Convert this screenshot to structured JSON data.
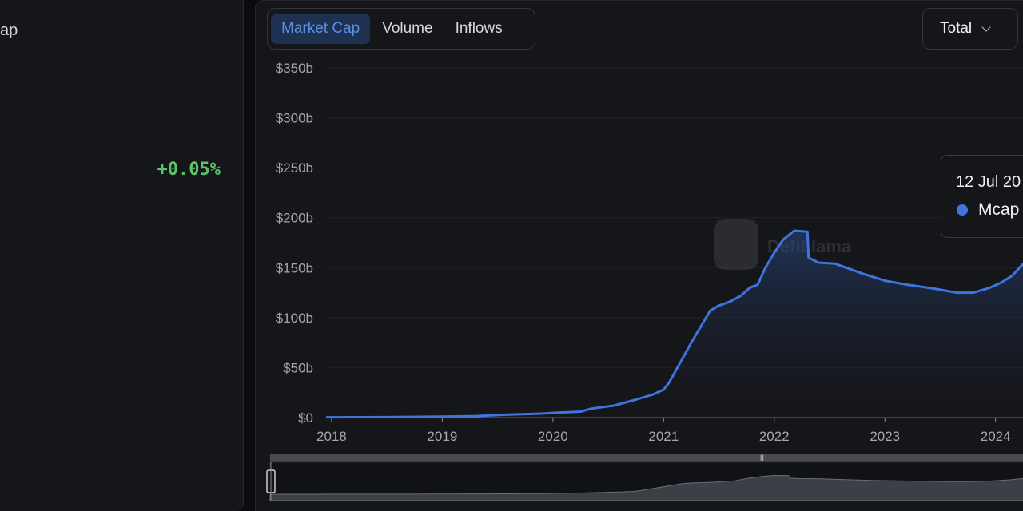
{
  "left": {
    "label": "ap",
    "change": "+0.05%",
    "change_color": "#5cc36b"
  },
  "tabs": [
    {
      "label": "Market Cap",
      "active": true
    },
    {
      "label": "Volume",
      "active": false
    },
    {
      "label": "Inflows",
      "active": false
    }
  ],
  "filter": {
    "label": "Total"
  },
  "tooltip": {
    "date": "12 Jul 20",
    "label": "Mcap",
    "color": "#3f74de"
  },
  "watermark": {
    "text": "DefiLlama"
  },
  "colors": {
    "line": "#3f74de",
    "accent": "#5b8fe2"
  },
  "chart_data": {
    "type": "area",
    "series": [
      {
        "name": "Mcap"
      }
    ],
    "y_ticks": [
      "$0",
      "$50b",
      "$100b",
      "$150b",
      "$200b",
      "$250b",
      "$300b",
      "$350b"
    ],
    "ylim": [
      0,
      350
    ],
    "x_ticks": [
      "2018",
      "2019",
      "2020",
      "2021",
      "2022",
      "2023",
      "2024"
    ],
    "xlim": [
      2017.95,
      2024.32
    ],
    "x": [
      2017.95,
      2018.5,
      2019.0,
      2019.3,
      2019.6,
      2019.9,
      2020.05,
      2020.25,
      2020.35,
      2020.55,
      2020.75,
      2020.9,
      2021.0,
      2021.05,
      2021.15,
      2021.25,
      2021.33,
      2021.42,
      2021.5,
      2021.6,
      2021.7,
      2021.78,
      2021.85,
      2021.92,
      2022.0,
      2022.08,
      2022.18,
      2022.3,
      2022.31,
      2022.4,
      2022.55,
      2022.65,
      2022.8,
      2023.0,
      2023.2,
      2023.45,
      2023.65,
      2023.8,
      2023.95,
      2024.05,
      2024.15,
      2024.25,
      2024.32
    ],
    "y": [
      0.3,
      0.5,
      1,
      1.5,
      3,
      4,
      5,
      6,
      9,
      12,
      18,
      23,
      28,
      35,
      55,
      75,
      90,
      107,
      112,
      116,
      122,
      130,
      133,
      150,
      165,
      178,
      187,
      186,
      160,
      155,
      154,
      150,
      144,
      137,
      133,
      129,
      125,
      125,
      130,
      135,
      142,
      154,
      160
    ],
    "xlabel": "",
    "ylabel": "",
    "grid": true,
    "legend": "none"
  }
}
